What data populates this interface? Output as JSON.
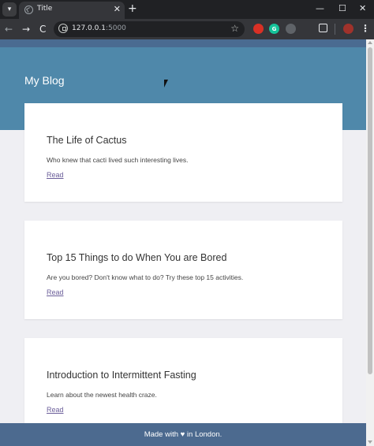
{
  "browser": {
    "tab_title": "Title",
    "close_glyph": "✕",
    "new_tab_glyph": "+",
    "url_host": "127.0.0.1",
    "url_port": ":5000",
    "window_controls": {
      "minimize": "—",
      "maximize": "☐",
      "close": "✕"
    },
    "nav": {
      "back": "←",
      "forward": "→",
      "reload": "C"
    },
    "star_glyph": "☆",
    "menu_glyph": "⋮",
    "extensions": [
      {
        "name": "red-extension-icon",
        "color": "#d93025",
        "glyph": ""
      },
      {
        "name": "grammarly-extension-icon",
        "color": "#15c39a",
        "glyph": "G"
      },
      {
        "name": "gray-extension-icon",
        "color": "#5f6368",
        "glyph": ""
      }
    ],
    "profile_color": "#a0322b"
  },
  "page": {
    "site_title": "My Blog",
    "colors": {
      "hero": "#4f88aa",
      "top_stripe": "#4a6b91",
      "footer": "#4c6a8f",
      "background": "#efeff3",
      "link": "#6b5e9a"
    },
    "posts": [
      {
        "title": "The Life of Cactus",
        "subtitle": "Who knew that cacti lived such interesting lives.",
        "link_label": "Read"
      },
      {
        "title": "Top 15 Things to do When You are Bored",
        "subtitle": "Are you bored? Don't know what to do? Try these top 15 activities.",
        "link_label": "Read"
      },
      {
        "title": "Introduction to Intermittent Fasting",
        "subtitle": "Learn about the newest health craze.",
        "link_label": "Read"
      }
    ],
    "footer_text": "Made with ♥ in London."
  }
}
